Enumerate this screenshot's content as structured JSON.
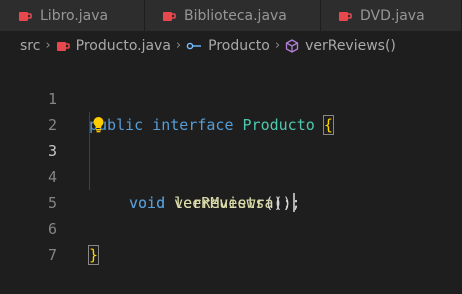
{
  "tabs": [
    {
      "label": "Libro.java"
    },
    {
      "label": "Biblioteca.java"
    },
    {
      "label": "DVD.java"
    }
  ],
  "breadcrumb": {
    "folder": "src",
    "file": "Producto.java",
    "symbol": "Producto",
    "method": "verReviews()"
  },
  "editor": {
    "line_numbers": [
      "1",
      "2",
      "3",
      "4",
      "5",
      "6",
      "7"
    ],
    "active_line": "3",
    "line1": {
      "kw1": "public",
      "kw2": "interface",
      "name": "Producto",
      "brace": "{"
    },
    "line3": {
      "kw": "void",
      "fn": "verReviews",
      "rest": "();"
    },
    "line4": {
      "kw": "void",
      "fn": "leerMuestra",
      "rest": "();"
    },
    "line6": {
      "brace": "}"
    }
  },
  "colors": {
    "java_icon": "#e8484c",
    "keyword": "#569cd6",
    "type": "#4ec9b0",
    "function": "#dcdcaa",
    "bracket": "#ffd700"
  },
  "icons": {
    "java_file": "coffee-cup-icon",
    "interface": "interface-icon",
    "method": "method-cube-icon",
    "lightbulb": "lightbulb-icon"
  }
}
